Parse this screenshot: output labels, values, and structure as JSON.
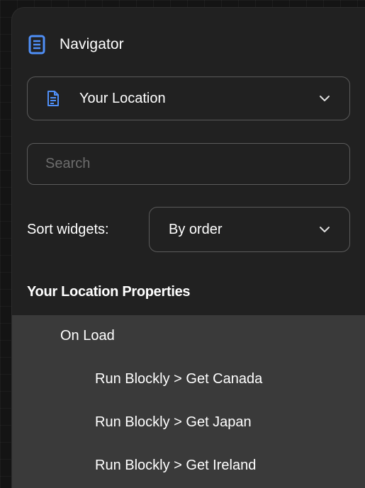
{
  "navigator": {
    "title": "Navigator",
    "icon": "navigator-list-icon",
    "accent_color": "#4f8ff7"
  },
  "page_select": {
    "icon": "document-icon",
    "value": "Your Location"
  },
  "search": {
    "placeholder": "Search",
    "value": ""
  },
  "sort": {
    "label": "Sort widgets:",
    "value": "By order"
  },
  "properties": {
    "title": "Your Location Properties",
    "events": [
      {
        "label": "On Load",
        "actions": [
          "Run Blockly > Get Canada",
          "Run Blockly > Get Japan",
          "Run Blockly > Get Ireland"
        ]
      }
    ]
  }
}
